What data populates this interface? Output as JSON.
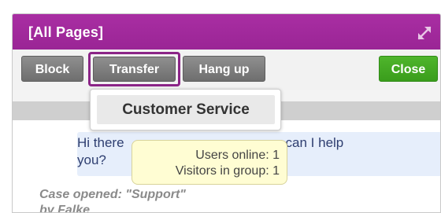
{
  "header": {
    "title": "[All Pages]",
    "expand_icon": "expand-arrows-icon",
    "brand_color": "#9a2595"
  },
  "toolbar": {
    "block_label": "Block",
    "transfer_label": "Transfer",
    "hangup_label": "Hang up",
    "close_label": "Close",
    "close_color": "#3a9d1c"
  },
  "transfer_menu": {
    "items": [
      {
        "label": "Customer Service"
      }
    ]
  },
  "tooltip": {
    "users_online": "Users online: 1",
    "visitors_in_group": "Visitors in group: 1"
  },
  "chat": {
    "message_line1": "Hi there",
    "message_tail": "w can I help",
    "message_line2": "you?",
    "case_line1": "Case opened: \"Support\"",
    "case_line2": "by Falke"
  }
}
